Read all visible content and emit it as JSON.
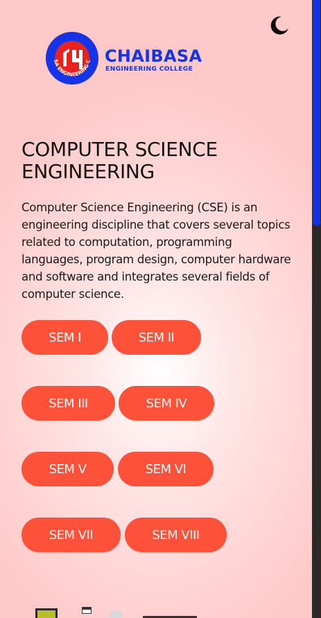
{
  "header": {
    "brand_name": "CHAIBASA",
    "brand_sub": "ENGINEERING COLLEGE",
    "logo_ring_text": "CHAIBASA ENGINEERING COLLEGE",
    "theme_toggle_icon": "moon-icon"
  },
  "department": {
    "title": "COMPUTER SCIENCE ENGINEERING",
    "description": "Computer Science Engineering (CSE) is an engineering discipline that covers several topics related to computation, programming languages, program design, computer hardware and software and integrates several fields of computer science."
  },
  "semesters": [
    "SEM I",
    "SEM II",
    "SEM III",
    "SEM IV",
    "SEM V",
    "SEM VI",
    "SEM VII",
    "SEM VIII"
  ],
  "colors": {
    "accent": "#fd5139",
    "brand": "#1534e6",
    "scroll_thumb": "#1432e0"
  }
}
